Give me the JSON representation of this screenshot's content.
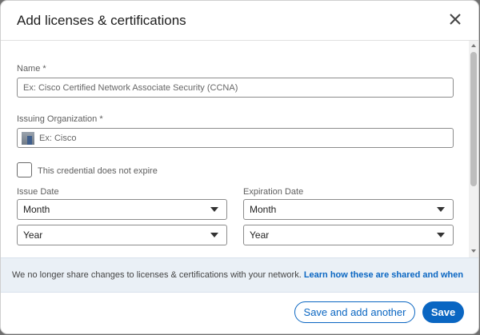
{
  "dialog": {
    "title": "Add licenses & certifications"
  },
  "form": {
    "name_label": "Name *",
    "name_placeholder": "Ex: Cisco Certified Network Associate Security (CCNA)",
    "org_label": "Issuing Organization *",
    "org_placeholder": "Ex: Cisco",
    "no_expire_label": "This credential does not expire",
    "no_expire_checked": false,
    "issue_date_label": "Issue Date",
    "expiration_date_label": "Expiration Date",
    "issue_month": "Month",
    "issue_year": "Year",
    "exp_month": "Month",
    "exp_year": "Year"
  },
  "notice": {
    "text": "We no longer share changes to licenses & certifications with your network. ",
    "link": "Learn how these are shared and when"
  },
  "footer": {
    "secondary_label": "Save and add another",
    "primary_label": "Save"
  },
  "colors": {
    "accent": "#0a66c2",
    "notice_bg": "#eaf0f6"
  },
  "icons": {
    "close": "close-icon",
    "org": "organization-logo-icon",
    "caret": "chevron-down-icon"
  }
}
